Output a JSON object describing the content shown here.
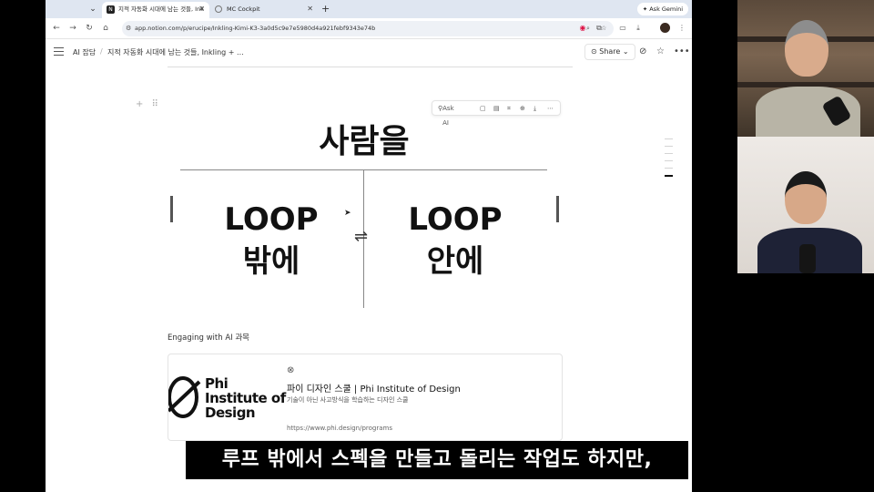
{
  "browser": {
    "tabs": [
      {
        "title": "지적 자동화 시대에 남는 것들, Ink",
        "active": true
      },
      {
        "title": "MC Cockpit",
        "active": false
      }
    ],
    "new_tab": "+",
    "ask_gemini": "Ask Gemini",
    "url": "app.notion.com/p/erucipe/Inkling-Kimi-K3-3a0d5c9e7e5980d4a921febf9343e74b"
  },
  "notion": {
    "breadcrumb": [
      "AI 잡담",
      "지적 자동화 시대에 남는 것들, Inkling + ..."
    ],
    "share_label": "Share",
    "image_toolbar": {
      "ask_ai": "Ask AI"
    },
    "diagram": {
      "title": "사람을",
      "left": "LOOP\n밖에",
      "left_line1": "LOOP",
      "left_line2": "밖에",
      "right_line1": "LOOP",
      "right_line2": "안에",
      "arrows": "⇌"
    },
    "section_label": "Engaging with AI 과목",
    "bookmark": {
      "logo_line1": "Phi",
      "logo_line2": "Institute of",
      "logo_line3": "Design",
      "title": "파이 디자인 스쿨 | Phi Institute of Design",
      "description": "기술이 아닌 사고방식을 학습하는 디자인 스쿨",
      "url": "https://www.phi.design/programs"
    }
  },
  "subtitle": "루프 밖에서 스펙을 만들고 돌리는 작업도 하지만,",
  "icons": {
    "tab_favicon": "notion-icon",
    "cockpit_favicon": "globe-icon",
    "gemini": "sparkle-icon"
  }
}
